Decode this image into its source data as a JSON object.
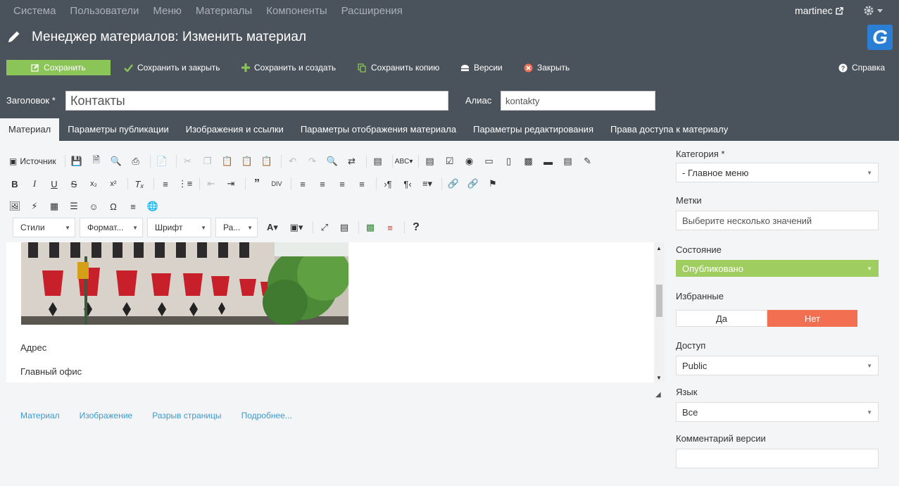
{
  "topnav": {
    "items": [
      "Система",
      "Пользователи",
      "Меню",
      "Материалы",
      "Компоненты",
      "Расширения"
    ],
    "user": "martinec"
  },
  "header": {
    "title": "Менеджер материалов: Изменить материал"
  },
  "toolbar": {
    "save": "Сохранить",
    "save_close": "Сохранить и закрыть",
    "save_new": "Сохранить и создать",
    "save_copy": "Сохранить копию",
    "versions": "Версии",
    "close": "Закрыть",
    "help": "Справка"
  },
  "fields": {
    "title_label": "Заголовок *",
    "title_value": "Контакты",
    "alias_label": "Алиас",
    "alias_value": "kontakty"
  },
  "tabs": [
    "Материал",
    "Параметры публикации",
    "Изображения и ссылки",
    "Параметры отображения материала",
    "Параметры редактирования",
    "Права доступа к материалу"
  ],
  "editor": {
    "source_label": "Источник",
    "dropdowns": [
      "Стили",
      "Формат...",
      "Шрифт",
      "Ра..."
    ],
    "content": [
      "Адрес",
      "Главный офис"
    ],
    "links": [
      "Материал",
      "Изображение",
      "Разрыв страницы",
      "Подробнее..."
    ]
  },
  "sidebar": {
    "category_label": "Категория *",
    "category_value": "- Главное меню",
    "tags_label": "Метки",
    "tags_placeholder": "Выберите несколько значений",
    "status_label": "Состояние",
    "status_value": "Опубликовано",
    "featured_label": "Избранные",
    "featured_yes": "Да",
    "featured_no": "Нет",
    "access_label": "Доступ",
    "access_value": "Public",
    "language_label": "Язык",
    "language_value": "Все",
    "version_note_label": "Комментарий версии"
  },
  "colors": {
    "header_bg": "#4a525b",
    "save_green": "#8bc557",
    "status_green": "#9fcd5f",
    "no_red": "#f26f52",
    "link_blue": "#3a9bd1"
  }
}
